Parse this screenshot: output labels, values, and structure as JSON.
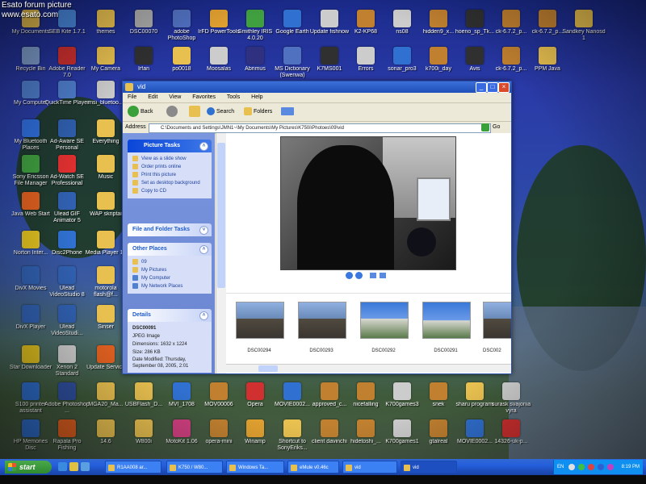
{
  "watermark": {
    "line1": "Esato forum picture",
    "line2": "www.esato.com"
  },
  "desktop_icons": [
    {
      "label": "My Documents",
      "color": "#e8c050",
      "col": 0,
      "row": 0
    },
    {
      "label": "SEB Kite 1.7.1",
      "color": "#4a8ae0",
      "col": 1,
      "row": 0
    },
    {
      "label": "themes",
      "color": "#e8c050",
      "col": 2,
      "row": 0
    },
    {
      "label": "DSC00070",
      "color": "#aaaaaa",
      "col": 3,
      "row": 0
    },
    {
      "label": "adobe PhotoShop",
      "color": "#5070c0",
      "col": 4,
      "row": 0
    },
    {
      "label": "IrFD PowerTools",
      "color": "#e0a030",
      "col": 5,
      "row": 0
    },
    {
      "label": "Smithley IRIS 4.0.20",
      "color": "#40a040",
      "col": 6,
      "row": 0
    },
    {
      "label": "Google Earth",
      "color": "#3070d0",
      "col": 7,
      "row": 0
    },
    {
      "label": "Update fishnow",
      "color": "#cccccc",
      "col": 8,
      "row": 0
    },
    {
      "label": "K2-KP68",
      "color": "#c08030",
      "col": 9,
      "row": 0
    },
    {
      "label": "ns08",
      "color": "#cccccc",
      "col": 10,
      "row": 0
    },
    {
      "label": "hidden9_x...",
      "color": "#c08030",
      "col": 11,
      "row": 0
    },
    {
      "label": "hoeno_sp_Tk...",
      "color": "#303030",
      "col": 12,
      "row": 0
    },
    {
      "label": "ck-6.7.2_p...",
      "color": "#c08030",
      "col": 13,
      "row": 0
    },
    {
      "label": "ck-6.7.2_p...",
      "color": "#c08030",
      "col": 14,
      "row": 0
    },
    {
      "label": "Sandkey Nanosd 1",
      "color": "#e8c050",
      "col": 15,
      "row": 0
    },
    {
      "label": "Recycle Bin",
      "color": "#80a0d0",
      "col": 0,
      "row": 1
    },
    {
      "label": "Adobe Reader 7.0",
      "color": "#d03030",
      "col": 1,
      "row": 1
    },
    {
      "label": "My Camera",
      "color": "#e8c050",
      "col": 2,
      "row": 1
    },
    {
      "label": "Irfan",
      "color": "#303030",
      "col": 3,
      "row": 1
    },
    {
      "label": "po0018",
      "color": "#e8c050",
      "col": 4,
      "row": 1
    },
    {
      "label": "Moosalas",
      "color": "#cccccc",
      "col": 5,
      "row": 1
    },
    {
      "label": "Abrimus",
      "color": "#303080",
      "col": 6,
      "row": 1
    },
    {
      "label": "MS Dictionary (Swenwa)",
      "color": "#5070c0",
      "col": 7,
      "row": 1
    },
    {
      "label": "K7MS001",
      "color": "#303030",
      "col": 8,
      "row": 1
    },
    {
      "label": "Errors",
      "color": "#cccccc",
      "col": 9,
      "row": 1
    },
    {
      "label": "sonar_pro3",
      "color": "#3070d0",
      "col": 10,
      "row": 1
    },
    {
      "label": "k700i_day",
      "color": "#c08030",
      "col": 11,
      "row": 1
    },
    {
      "label": "Avis",
      "color": "#303030",
      "col": 12,
      "row": 1
    },
    {
      "label": "ck-6.7.2_p...",
      "color": "#c08030",
      "col": 13,
      "row": 1
    },
    {
      "label": "PPM Java",
      "color": "#e8c050",
      "col": 14,
      "row": 1
    },
    {
      "label": "My Computer",
      "color": "#5080d0",
      "col": 0,
      "row": 2
    },
    {
      "label": "QuickTime Player",
      "color": "#5080d0",
      "col": 1,
      "row": 2
    },
    {
      "label": "msi_bluetoo...",
      "color": "#cccccc",
      "col": 2,
      "row": 2
    },
    {
      "label": "My Bluetooth Places",
      "color": "#3070e0",
      "col": 0,
      "row": 3
    },
    {
      "label": "Ad-Aware SE Personal",
      "color": "#3060b0",
      "col": 1,
      "row": 3
    },
    {
      "label": "Everything",
      "color": "#e8c050",
      "col": 2,
      "row": 3
    },
    {
      "label": "Sony Ericsson File Manager",
      "color": "#40a040",
      "col": 0,
      "row": 4
    },
    {
      "label": "Ad-Watch SE Professional",
      "color": "#e03030",
      "col": 1,
      "row": 4
    },
    {
      "label": "Music",
      "color": "#e8c050",
      "col": 2,
      "row": 4
    },
    {
      "label": "Java Web Start",
      "color": "#e06020",
      "col": 0,
      "row": 5
    },
    {
      "label": "Ulead GIF Animator 5",
      "color": "#3060b0",
      "col": 1,
      "row": 5
    },
    {
      "label": "WAP skriptai",
      "color": "#e8c050",
      "col": 2,
      "row": 5
    },
    {
      "label": "Norton Inter...",
      "color": "#e0c020",
      "col": 0,
      "row": 6
    },
    {
      "label": "Disc2Phone",
      "color": "#3070d0",
      "col": 1,
      "row": 6
    },
    {
      "label": "Media Player 10",
      "color": "#e8c050",
      "col": 2,
      "row": 6
    },
    {
      "label": "DivX Movies",
      "color": "#3060b0",
      "col": 0,
      "row": 7
    },
    {
      "label": "Ulead VideoStudio 8",
      "color": "#3060b0",
      "col": 1,
      "row": 7
    },
    {
      "label": "motorola flash@f...",
      "color": "#e8c050",
      "col": 2,
      "row": 7
    },
    {
      "label": "DivX Player",
      "color": "#3060b0",
      "col": 0,
      "row": 8
    },
    {
      "label": "Ulead VideoStudi...",
      "color": "#3060b0",
      "col": 1,
      "row": 8
    },
    {
      "label": "Sinser",
      "color": "#e8c050",
      "col": 2,
      "row": 8
    },
    {
      "label": "Star Downloader",
      "color": "#e0c020",
      "col": 0,
      "row": 9
    },
    {
      "label": "Xenon 2 Standard",
      "color": "#cccccc",
      "col": 1,
      "row": 9
    },
    {
      "label": "Update Service",
      "color": "#e06020",
      "col": 2,
      "row": 9
    },
    {
      "label": "S100 printer assistant",
      "color": "#3070d0",
      "col": 0,
      "row": 10
    },
    {
      "label": "Adobe Photoshop ...",
      "color": "#3050a0",
      "col": 1,
      "row": 10
    },
    {
      "label": "MGA20_Ma...",
      "color": "#e8c050",
      "col": 2,
      "row": 10
    },
    {
      "label": "USBFlash_D...",
      "color": "#e8c050",
      "col": 3,
      "row": 10
    },
    {
      "label": "MVI_1708",
      "color": "#3070d0",
      "col": 4,
      "row": 10
    },
    {
      "label": "MOV00006",
      "color": "#c08030",
      "col": 5,
      "row": 10
    },
    {
      "label": "Opera",
      "color": "#d03030",
      "col": 6,
      "row": 10
    },
    {
      "label": "MOVIE0002...",
      "color": "#3070d0",
      "col": 7,
      "row": 10
    },
    {
      "label": "approved_c...",
      "color": "#c08030",
      "col": 8,
      "row": 10
    },
    {
      "label": "nicefalling",
      "color": "#c08030",
      "col": 9,
      "row": 10
    },
    {
      "label": "K700games3",
      "color": "#cccccc",
      "col": 10,
      "row": 10
    },
    {
      "label": "snek",
      "color": "#c08030",
      "col": 11,
      "row": 10
    },
    {
      "label": "sharu programi",
      "color": "#e8c050",
      "col": 12,
      "row": 10
    },
    {
      "label": "surask svajonia vyra",
      "color": "#cccccc",
      "col": 13,
      "row": 10
    },
    {
      "label": "HP Memories Disc",
      "color": "#3070d0",
      "col": 0,
      "row": 11
    },
    {
      "label": "Rapala Pro Fishing",
      "color": "#e06020",
      "col": 1,
      "row": 11
    },
    {
      "label": "14.6",
      "color": "#e8c050",
      "col": 2,
      "row": 11
    },
    {
      "label": "W800i",
      "color": "#e8c050",
      "col": 3,
      "row": 11
    },
    {
      "label": "MotoKit 1.06",
      "color": "#d04080",
      "col": 4,
      "row": 11
    },
    {
      "label": "opera-mini",
      "color": "#c08030",
      "col": 5,
      "row": 11
    },
    {
      "label": "Winamp",
      "color": "#e0a030",
      "col": 6,
      "row": 11
    },
    {
      "label": "Shortcut to SonyEriks...",
      "color": "#e8c050",
      "col": 7,
      "row": 11
    },
    {
      "label": "client davinchi",
      "color": "#c08030",
      "col": 8,
      "row": 11
    },
    {
      "label": "hidetoshi_...",
      "color": "#c08030",
      "col": 9,
      "row": 11
    },
    {
      "label": "K700games1",
      "color": "#cccccc",
      "col": 10,
      "row": 11
    },
    {
      "label": "gtalreal",
      "color": "#c08030",
      "col": 11,
      "row": 11
    },
    {
      "label": "MOVIE0002...",
      "color": "#3070d0",
      "col": 12,
      "row": 11
    },
    {
      "label": "14326-uk-p...",
      "color": "#d03030",
      "col": 13,
      "row": 11
    }
  ],
  "window": {
    "title": "vid",
    "menu": [
      "File",
      "Edit",
      "View",
      "Favorites",
      "Tools",
      "Help"
    ],
    "toolbar": {
      "back": "Back",
      "search": "Search",
      "folders": "Folders"
    },
    "address": {
      "label": "Address",
      "path": "C:\\Documents and Settings\\JMN1~\\My Documents\\My Pictures\\K750i\\Photoes\\09\\vid",
      "go": "Go"
    },
    "tasks": {
      "picture_tasks": {
        "title": "Picture Tasks",
        "items": [
          "View as a slide show",
          "Order prints online",
          "Print this picture",
          "Set as desktop background",
          "Copy to CD"
        ]
      },
      "file_folder_tasks": {
        "title": "File and Folder Tasks"
      },
      "other_places": {
        "title": "Other Places",
        "items": [
          "09",
          "My Pictures",
          "My Computer",
          "My Network Places"
        ]
      },
      "details": {
        "title": "Details",
        "name": "DSC00091",
        "type": "JPEG Image",
        "dimensions": "Dimensions: 1632 x 1224",
        "size": "Size: 286 KB",
        "modified": "Date Modified: Thursday, September 08, 2005, 2:01"
      }
    },
    "thumbnails": [
      "DSC00294",
      "DSC00293",
      "DSC00292",
      "DSC00291",
      "DSC002"
    ]
  },
  "taskbar": {
    "start": "start",
    "tasks": [
      {
        "label": "R1AA008 ar...",
        "active": false
      },
      {
        "label": "K750 / W80...",
        "active": false
      },
      {
        "label": "Windows Ta...",
        "active": false
      },
      {
        "label": "eMule v0.46c",
        "active": false
      },
      {
        "label": "vid",
        "active": false
      },
      {
        "label": "vid",
        "active": true
      }
    ],
    "tray": {
      "lang": "EN",
      "clock": "8:19 PM"
    }
  }
}
